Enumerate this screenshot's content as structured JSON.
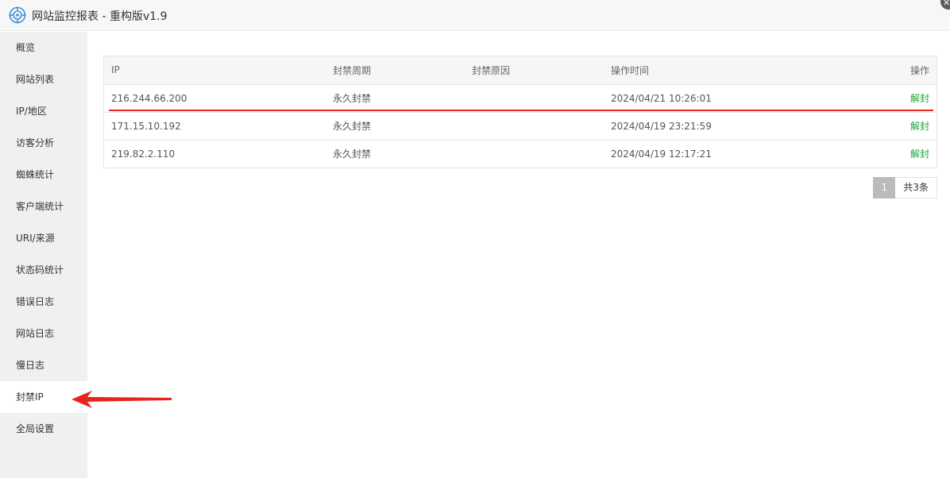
{
  "window": {
    "title": "网站监控报表 - 重构版v1.9",
    "close_glyph": "✕"
  },
  "sidebar": {
    "items": [
      {
        "label": "概览",
        "active": false
      },
      {
        "label": "网站列表",
        "active": false
      },
      {
        "label": "IP/地区",
        "active": false
      },
      {
        "label": "访客分析",
        "active": false
      },
      {
        "label": "蜘蛛统计",
        "active": false
      },
      {
        "label": "客户端统计",
        "active": false
      },
      {
        "label": "URI/来源",
        "active": false
      },
      {
        "label": "状态码统计",
        "active": false
      },
      {
        "label": "错误日志",
        "active": false
      },
      {
        "label": "网站日志",
        "active": false
      },
      {
        "label": "慢日志",
        "active": false
      },
      {
        "label": "封禁IP",
        "active": true
      },
      {
        "label": "全局设置",
        "active": false
      }
    ]
  },
  "table": {
    "columns": [
      "IP",
      "封禁周期",
      "封禁原因",
      "操作时间",
      "操作"
    ],
    "rows": [
      {
        "ip": "216.244.66.200",
        "period": "永久封禁",
        "reason": "",
        "time": "2024/04/21 10:26:01",
        "action": "解封"
      },
      {
        "ip": "171.15.10.192",
        "period": "永久封禁",
        "reason": "",
        "time": "2024/04/19 23:21:59",
        "action": "解封"
      },
      {
        "ip": "219.82.2.110",
        "period": "永久封禁",
        "reason": "",
        "time": "2024/04/19 12:17:21",
        "action": "解封"
      }
    ]
  },
  "pagination": {
    "current_page": "1",
    "total_text": "共3条"
  },
  "colors": {
    "action_green": "#20a53a",
    "annotation_red": "#e8231d",
    "sidebar_bg": "#f0f0f0"
  }
}
